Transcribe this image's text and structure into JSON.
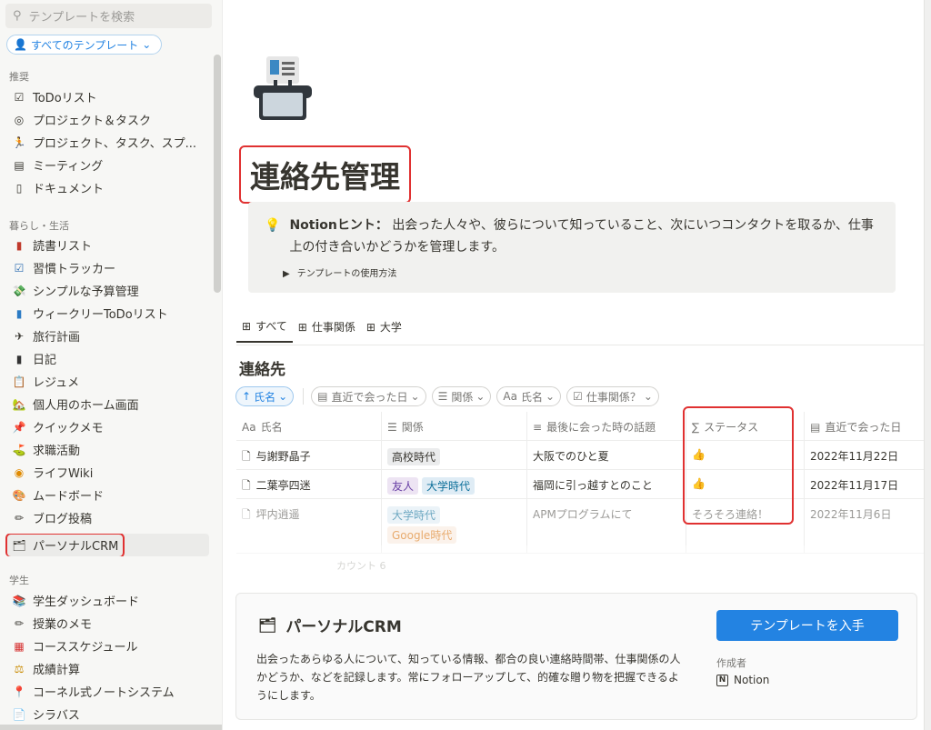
{
  "sidebar": {
    "search_placeholder": "テンプレートを検索",
    "filter_label": "すべてのテンプレート",
    "sections": [
      {
        "label": "推奨"
      },
      {
        "label": "暮らし・生活"
      },
      {
        "label": "学生"
      }
    ],
    "recommended": [
      {
        "label": "ToDoリスト",
        "icon": "checkbox-icon"
      },
      {
        "label": "プロジェクト＆タスク",
        "icon": "target-icon"
      },
      {
        "label": "プロジェクト、タスク、スプ...",
        "icon": "runner-icon"
      },
      {
        "label": "ミーティング",
        "icon": "calendar-icon"
      },
      {
        "label": "ドキュメント",
        "icon": "document-icon"
      }
    ],
    "life": [
      {
        "label": "読書リスト",
        "icon": "book-icon"
      },
      {
        "label": "習慣トラッカー",
        "icon": "check-box-icon"
      },
      {
        "label": "シンプルな予算管理",
        "icon": "money-icon"
      },
      {
        "label": "ウィークリーToDoリスト",
        "icon": "notebook-icon"
      },
      {
        "label": "旅行計画",
        "icon": "airplane-icon"
      },
      {
        "label": "日記",
        "icon": "journal-icon"
      },
      {
        "label": "レジュメ",
        "icon": "clipboard-icon"
      },
      {
        "label": "個人用のホーム画面",
        "icon": "house-icon"
      },
      {
        "label": "クイックメモ",
        "icon": "pushpin-icon"
      },
      {
        "label": "求職活動",
        "icon": "flag-icon"
      },
      {
        "label": "ライフWiki",
        "icon": "compass-icon"
      },
      {
        "label": "ムードボード",
        "icon": "palette-icon"
      },
      {
        "label": "ブログ投稿",
        "icon": "pencil-icon"
      },
      {
        "label": "パーソナルCRM",
        "icon": "card-index-icon"
      }
    ],
    "student": [
      {
        "label": "学生ダッシュボード",
        "icon": "books-icon"
      },
      {
        "label": "授業のメモ",
        "icon": "pencil-icon"
      },
      {
        "label": "コーススケジュール",
        "icon": "calendar-icon"
      },
      {
        "label": "成績計算",
        "icon": "scales-icon"
      },
      {
        "label": "コーネル式ノートシステム",
        "icon": "pin-icon"
      },
      {
        "label": "シラバス",
        "icon": "page-icon"
      }
    ]
  },
  "main": {
    "title": "連絡先管理",
    "hint_brand": "Notionヒント：",
    "hint_text": "出会った人々や、彼らについて知っていること、次にいつコンタクトを取るか、仕事上の付き合いかどうかを管理します。",
    "hint_toggle": "テンプレートの使用方法",
    "tabs": [
      "すべて",
      "仕事関係",
      "大学"
    ],
    "db_title": "連絡先",
    "filters": [
      "氏名",
      "直近で会った日",
      "関係",
      "氏名",
      "仕事関係？"
    ],
    "columns": [
      "氏名",
      "関係",
      "最後に会った時の話題",
      "ステータス",
      "直近で会った日"
    ],
    "rows": [
      {
        "name": "与謝野晶子",
        "tags": [
          "高校時代"
        ],
        "topic": "大阪でのひと夏",
        "status": "👍",
        "date": "2022年11月22日"
      },
      {
        "name": "二葉亭四迷",
        "tags": [
          "友人",
          "大学時代"
        ],
        "topic": "福岡に引っ越すとのこと",
        "status": "👍",
        "date": "2022年11月17日"
      },
      {
        "name": "坪内逍遥",
        "tags": [
          "大学時代",
          "Google時代"
        ],
        "topic": "APMプログラムにて",
        "status": "そろそろ連絡！",
        "date": "2022年11月6日"
      }
    ],
    "faded_count": "カウント 6"
  },
  "card": {
    "title": "パーソナルCRM",
    "description": "出会ったあらゆる人について、知っている情報、都合の良い連絡時間帯、仕事関係の人かどうか、などを記録します。常にフォローアップして、的確な贈り物を把握できるようにします。",
    "button": "テンプレートを入手",
    "author_label": "作成者",
    "author": "Notion"
  }
}
